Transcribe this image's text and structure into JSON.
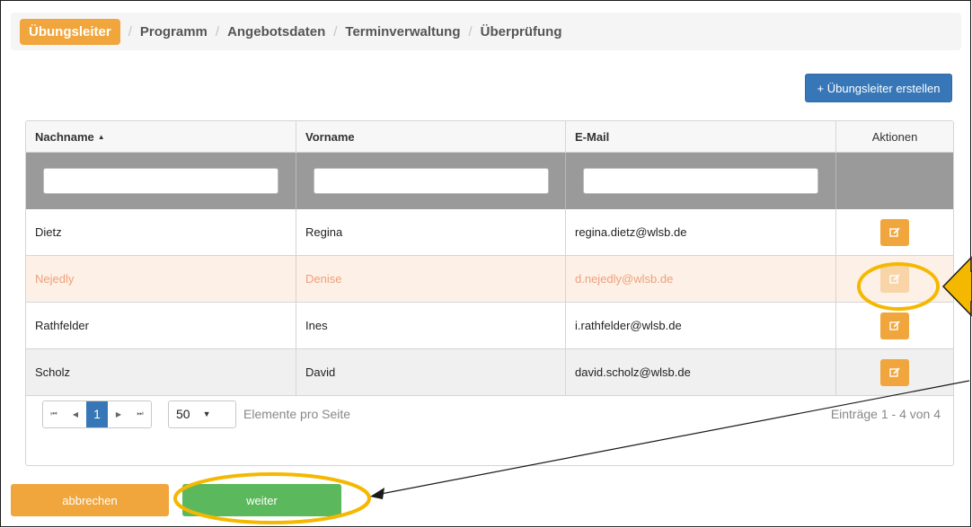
{
  "wizard": {
    "steps": [
      "Übungsleiter",
      "Programm",
      "Angebotsdaten",
      "Terminverwaltung",
      "Überprüfung"
    ],
    "separator": "/"
  },
  "toolbar": {
    "create_label": "+ Übungsleiter erstellen"
  },
  "grid": {
    "columns": [
      "Nachname",
      "Vorname",
      "E-Mail",
      "Aktionen"
    ],
    "sort_indicator": "▲",
    "rows": [
      {
        "last": "Dietz",
        "first": "Regina",
        "email": "regina.dietz@wlsb.de"
      },
      {
        "last": "Nejedly",
        "first": "Denise",
        "email": "d.nejedly@wlsb.de"
      },
      {
        "last": "Rathfelder",
        "first": "Ines",
        "email": "i.rathfelder@wlsb.de"
      },
      {
        "last": "Scholz",
        "first": "David",
        "email": "david.scholz@wlsb.de"
      }
    ]
  },
  "pager": {
    "first": "⏮",
    "prev": "◀",
    "page": "1",
    "next": "▶",
    "last": "⏭",
    "page_size": "50",
    "page_size_caret": "▼",
    "per_page_label": "Elemente pro Seite",
    "info": "Einträge 1 - 4 von 4"
  },
  "footer": {
    "cancel_label": "abbrechen",
    "next_label": "weiter"
  },
  "colors": {
    "accent_orange": "#f0a63c",
    "primary_blue": "#3777b7",
    "success_green": "#5cb85c",
    "annotation_yellow": "#f5b800"
  },
  "icons": {
    "edit": "edit-icon"
  }
}
